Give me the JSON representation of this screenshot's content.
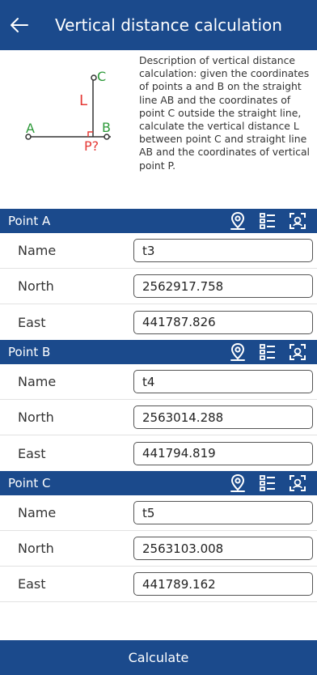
{
  "header": {
    "title": "Vertical distance calculation",
    "back_icon": "arrow-left-icon"
  },
  "description": {
    "text": "Description of vertical distance calculation: given the coordinates of points a and B on the straight line AB and the coordinates of point C outside the straight line, calculate the vertical distance L between point C and straight line AB and the coordinates of vertical point P.",
    "diagram": {
      "label_a": "A",
      "label_b": "B",
      "label_c": "C",
      "label_l": "L",
      "label_p": "P?"
    }
  },
  "points": [
    {
      "title": "Point A",
      "fields": [
        {
          "label": "Name",
          "value": "t3"
        },
        {
          "label": "North",
          "value": "2562917.758"
        },
        {
          "label": "East",
          "value": "441787.826"
        }
      ]
    },
    {
      "title": "Point B",
      "fields": [
        {
          "label": "Name",
          "value": "t4"
        },
        {
          "label": "North",
          "value": "2563014.288"
        },
        {
          "label": "East",
          "value": "441794.819"
        }
      ]
    },
    {
      "title": "Point C",
      "fields": [
        {
          "label": "Name",
          "value": "t5"
        },
        {
          "label": "North",
          "value": "2563103.008"
        },
        {
          "label": "East",
          "value": "441789.162"
        }
      ]
    }
  ],
  "header_icons": [
    "location-pin-icon",
    "point-list-icon",
    "scan-icon"
  ],
  "colors": {
    "primary": "#1b4a8c",
    "diagram_red": "#e53935",
    "diagram_green": "#2e9a3a"
  },
  "calculate_button": "Calculate"
}
